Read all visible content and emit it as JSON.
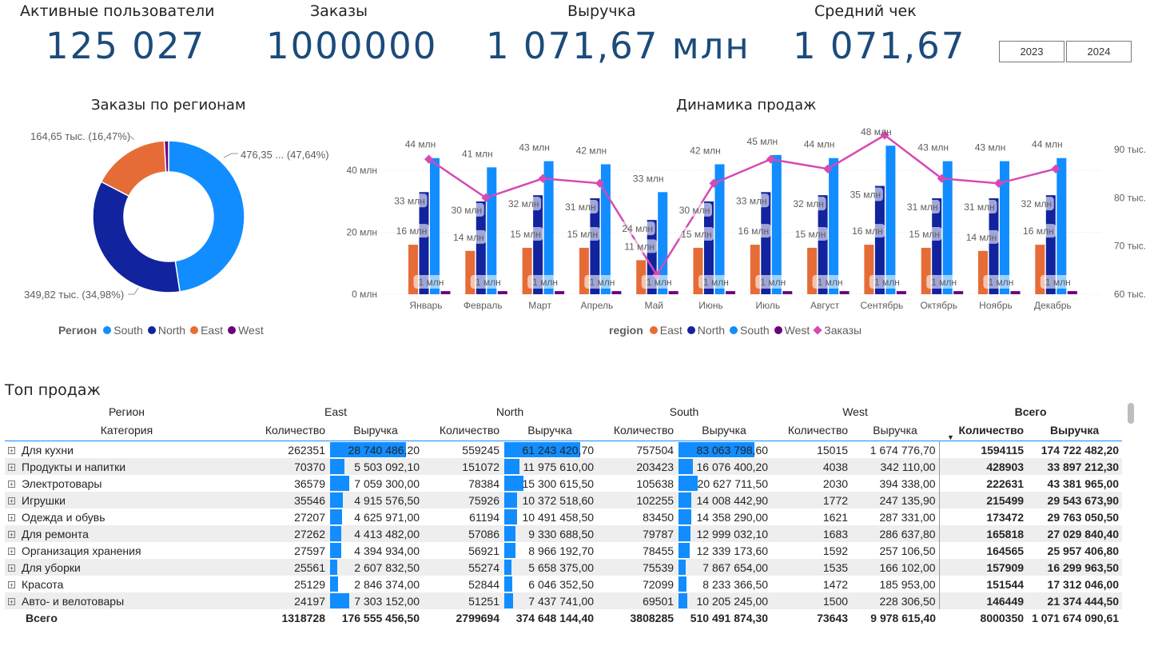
{
  "kpis": {
    "active_users": {
      "label": "Активные пользователи",
      "value": "125 027"
    },
    "orders": {
      "label": "Заказы",
      "value": "1000000"
    },
    "revenue": {
      "label": "Выручка",
      "value": "1 071,67 млн"
    },
    "avg_check": {
      "label": "Средний чек",
      "value": "1 071,67"
    }
  },
  "year_buttons": [
    "2023",
    "2024"
  ],
  "colors": {
    "east": "#e66c37",
    "north": "#12239e",
    "south": "#118dff",
    "west": "#6b007b",
    "orders": "#d64ab4",
    "kpi": "#1b4b7a"
  },
  "donut": {
    "title": "Заказы по регионам",
    "labels": {
      "south": "476,35 ... (47,64%)",
      "north": "349,82 тыс. (34,98%)",
      "east": "164,65 тыс. (16,47%)"
    },
    "legend_title": "Регион",
    "legend": [
      "South",
      "North",
      "East",
      "West"
    ],
    "chart_data": {
      "type": "pie",
      "categories": [
        "South",
        "North",
        "East",
        "West"
      ],
      "values": [
        476.35,
        349.82,
        164.65,
        9.18
      ]
    }
  },
  "combo": {
    "title": "Динамика продаж",
    "legend_title": "region",
    "legend": [
      "East",
      "North",
      "South",
      "West",
      "Заказы"
    ],
    "y_left_ticks": [
      "0 млн",
      "20 млн",
      "40 млн"
    ],
    "y_right_ticks": [
      "60 тыс.",
      "70 тыс.",
      "80 тыс.",
      "90 тыс."
    ],
    "chart_data": {
      "type": "bar",
      "categories": [
        "Январь",
        "Февраль",
        "Март",
        "Апрель",
        "Май",
        "Июнь",
        "Июль",
        "Август",
        "Сентябрь",
        "Октябрь",
        "Ноябрь",
        "Декабрь"
      ],
      "ylim": [
        0,
        50
      ],
      "y2lim": [
        60,
        90
      ],
      "series": [
        {
          "name": "East",
          "values": [
            16,
            14,
            15,
            15,
            11,
            15,
            16,
            15,
            16,
            15,
            14,
            16
          ],
          "labels": [
            "16 млн",
            "14 млн",
            "15 млн",
            "15 млн",
            "11 млн",
            "15 млн",
            "16 млн",
            "15 млн",
            "16 млн",
            "15 млн",
            "14 млн",
            "16 млн"
          ]
        },
        {
          "name": "North",
          "values": [
            33,
            30,
            32,
            31,
            24,
            30,
            33,
            32,
            35,
            31,
            31,
            32
          ],
          "labels": [
            "33 млн",
            "30 млн",
            "32 млн",
            "31 млн",
            "24 млн",
            "30 млн",
            "33 млн",
            "32 млн",
            "35 млн",
            "31 млн",
            "31 млн",
            "32 млн"
          ]
        },
        {
          "name": "South",
          "values": [
            44,
            41,
            43,
            42,
            33,
            42,
            45,
            44,
            48,
            43,
            43,
            44
          ],
          "labels": [
            "44 млн",
            "41 млн",
            "43 млн",
            "42 млн",
            "33 млн",
            "42 млн",
            "45 млн",
            "44 млн",
            "48 млн",
            "43 млн",
            "43 млн",
            "44 млн"
          ]
        },
        {
          "name": "West",
          "values": [
            1,
            1,
            1,
            1,
            1,
            1,
            1,
            1,
            1,
            1,
            1,
            1
          ],
          "labels": [
            "1 млн",
            "1 млн",
            "1 млн",
            "1 млн",
            "1 млн",
            "1 млн",
            "1 млн",
            "1 млн",
            "1 млн",
            "1 млн",
            "1 млн",
            "1 млн"
          ]
        },
        {
          "name": "Заказы",
          "values": [
            88,
            80,
            84,
            83,
            64,
            83,
            88,
            86,
            93,
            84,
            83,
            86
          ]
        }
      ]
    }
  },
  "table": {
    "title": "Топ продаж",
    "header_region": "Регион",
    "header_category": "Категория",
    "groups": [
      "East",
      "North",
      "South",
      "West",
      "Всего"
    ],
    "col_qty": "Количество",
    "col_rev": "Выручка",
    "rows": [
      {
        "cat": "Для кухни",
        "e": [
          "262351",
          "28 740 486,20"
        ],
        "n": [
          "559245",
          "61 243 420,70"
        ],
        "s": [
          "757504",
          "83 063 798,60"
        ],
        "w": [
          "15015",
          "1 674 776,70"
        ],
        "t": [
          "1594115",
          "174 722 482,20"
        ],
        "bars": [
          1,
          1,
          1
        ]
      },
      {
        "cat": "Продукты и напитки",
        "e": [
          "70370",
          "5 503 092,10"
        ],
        "n": [
          "151072",
          "11 975 610,00"
        ],
        "s": [
          "203423",
          "16 076 400,20"
        ],
        "w": [
          "4038",
          "342 110,00"
        ],
        "t": [
          "428903",
          "33 897 212,30"
        ],
        "bars": [
          0.19,
          0.2,
          0.19
        ]
      },
      {
        "cat": "Электротовары",
        "e": [
          "36579",
          "7 059 300,00"
        ],
        "n": [
          "78384",
          "15 300 615,50"
        ],
        "s": [
          "105638",
          "20 627 711,50"
        ],
        "w": [
          "2030",
          "394 338,00"
        ],
        "t": [
          "222631",
          "43 381 965,00"
        ],
        "bars": [
          0.25,
          0.25,
          0.25
        ]
      },
      {
        "cat": "Игрушки",
        "e": [
          "35546",
          "4 915 576,50"
        ],
        "n": [
          "75926",
          "10 372 518,60"
        ],
        "s": [
          "102255",
          "14 008 442,90"
        ],
        "w": [
          "1772",
          "247 135,90"
        ],
        "t": [
          "215499",
          "29 543 673,90"
        ],
        "bars": [
          0.17,
          0.17,
          0.17
        ]
      },
      {
        "cat": "Одежда и обувь",
        "e": [
          "27207",
          "4 625 971,00"
        ],
        "n": [
          "61194",
          "10 491 458,50"
        ],
        "s": [
          "83450",
          "14 358 290,00"
        ],
        "w": [
          "1621",
          "287 331,00"
        ],
        "t": [
          "173472",
          "29 763 050,50"
        ],
        "bars": [
          0.16,
          0.17,
          0.17
        ]
      },
      {
        "cat": "Для ремонта",
        "e": [
          "27262",
          "4 413 482,00"
        ],
        "n": [
          "57086",
          "9 330 688,50"
        ],
        "s": [
          "79787",
          "12 999 032,10"
        ],
        "w": [
          "1683",
          "286 637,80"
        ],
        "t": [
          "165818",
          "27 029 840,40"
        ],
        "bars": [
          0.15,
          0.15,
          0.16
        ]
      },
      {
        "cat": "Организация хранения",
        "e": [
          "27597",
          "4 394 934,00"
        ],
        "n": [
          "56921",
          "8 966 192,70"
        ],
        "s": [
          "78455",
          "12 339 173,60"
        ],
        "w": [
          "1592",
          "257 106,50"
        ],
        "t": [
          "164565",
          "25 957 406,80"
        ],
        "bars": [
          0.15,
          0.15,
          0.15
        ]
      },
      {
        "cat": "Для уборки",
        "e": [
          "25561",
          "2 607 832,50"
        ],
        "n": [
          "55274",
          "5 658 375,00"
        ],
        "s": [
          "75539",
          "7 867 654,00"
        ],
        "w": [
          "1535",
          "166 102,00"
        ],
        "t": [
          "157909",
          "16 299 963,50"
        ],
        "bars": [
          0.09,
          0.09,
          0.09
        ]
      },
      {
        "cat": "Красота",
        "e": [
          "25129",
          "2 846 374,00"
        ],
        "n": [
          "52844",
          "6 046 352,50"
        ],
        "s": [
          "72099",
          "8 233 366,50"
        ],
        "w": [
          "1472",
          "185 953,00"
        ],
        "t": [
          "151544",
          "17 312 046,00"
        ],
        "bars": [
          0.1,
          0.1,
          0.1
        ]
      },
      {
        "cat": "Авто- и велотовары",
        "e": [
          "24197",
          "7 303 152,00"
        ],
        "n": [
          "51251",
          "7 437 741,00"
        ],
        "s": [
          "69501",
          "10 205 245,00"
        ],
        "w": [
          "1500",
          "228 306,50"
        ],
        "t": [
          "146449",
          "21 374 444,50"
        ],
        "bars": [
          0.25,
          0.12,
          0.12
        ]
      }
    ],
    "total": {
      "label": "Всего",
      "e": [
        "1318728",
        "176 555 456,50"
      ],
      "n": [
        "2799694",
        "374 648 144,40"
      ],
      "s": [
        "3808285",
        "510 491 874,30"
      ],
      "w": [
        "73643",
        "9 978 615,40"
      ],
      "t": [
        "8000350",
        "1 071 674 090,61"
      ]
    }
  }
}
